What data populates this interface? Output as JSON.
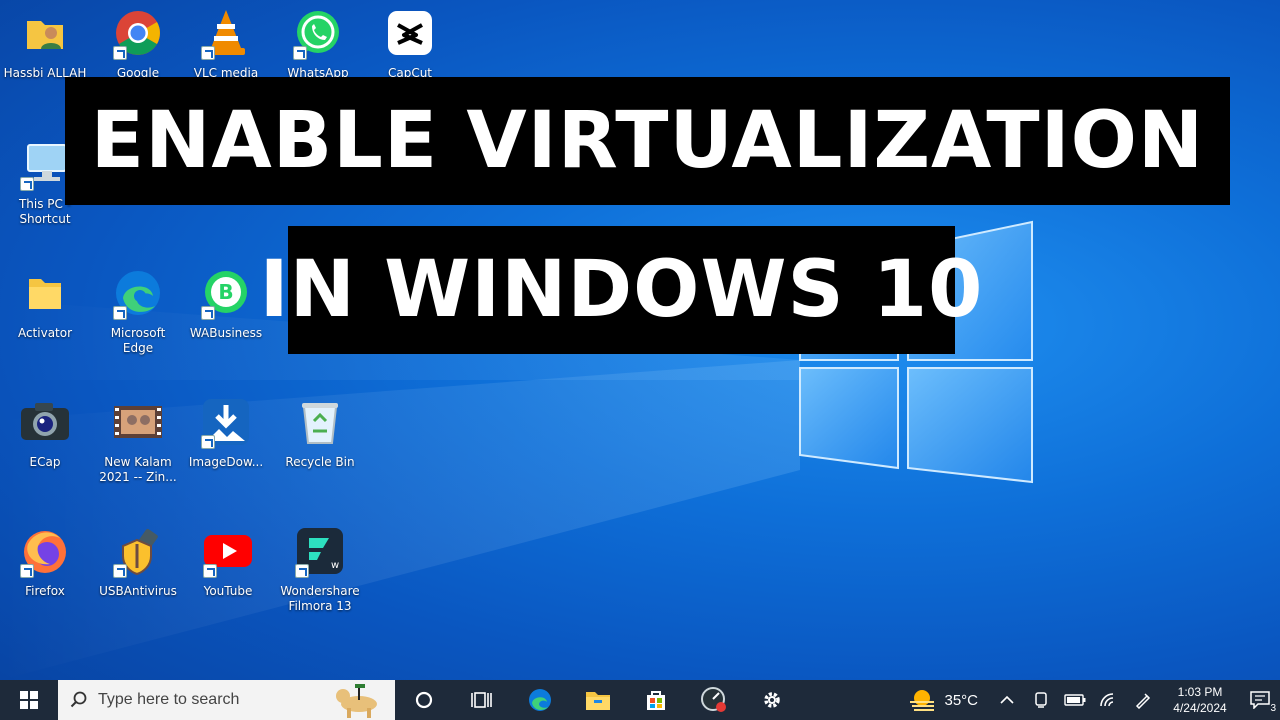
{
  "title": {
    "line1": "ENABLE VIRTUALIZATION",
    "line2": "IN WINDOWS 10"
  },
  "desktop_icons": [
    {
      "label": "Hassbi ALLAH",
      "icon": "user-folder-icon"
    },
    {
      "label": "Google",
      "icon": "chrome-icon"
    },
    {
      "label": "VLC media",
      "icon": "vlc-icon"
    },
    {
      "label": "WhatsApp",
      "icon": "whatsapp-icon"
    },
    {
      "label": "CapCut",
      "icon": "capcut-icon"
    },
    {
      "label": "This PC - Shortcut",
      "icon": "this-pc-icon"
    },
    {
      "label": "Activator",
      "icon": "folder-icon"
    },
    {
      "label": "Microsoft Edge",
      "icon": "edge-icon"
    },
    {
      "label": "WABusiness",
      "icon": "whatsapp-business-icon"
    },
    {
      "label": "ECap",
      "icon": "camera-icon"
    },
    {
      "label": "New Kalam 2021 -- Zin...",
      "icon": "video-file-icon"
    },
    {
      "label": "ImageDow...",
      "icon": "image-downloader-icon"
    },
    {
      "label": "Recycle Bin",
      "icon": "recycle-bin-icon"
    },
    {
      "label": "Firefox",
      "icon": "firefox-icon"
    },
    {
      "label": "USBAntivirus",
      "icon": "usb-antivirus-icon"
    },
    {
      "label": "YouTube",
      "icon": "youtube-icon"
    },
    {
      "label": "Wondershare Filmora 13",
      "icon": "filmora-icon"
    }
  ],
  "taskbar": {
    "search_placeholder": "Type here to search",
    "apps": [
      "cortana-icon",
      "task-view-icon",
      "edge-icon",
      "file-explorer-icon",
      "store-icon",
      "screen-recorder-icon",
      "settings-icon"
    ],
    "weather": "35°C",
    "time": "1:03 PM",
    "date": "4/24/2024",
    "notification_count": "3"
  },
  "colors": {
    "taskbar": "#1e2a3a",
    "wallpaper": "#0e6fd8",
    "banner": "#000000"
  }
}
